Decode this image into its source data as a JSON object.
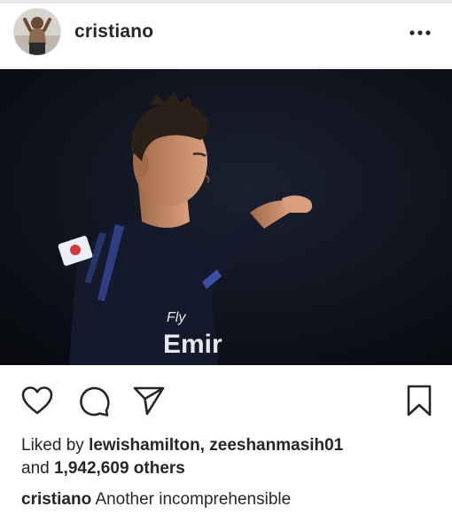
{
  "header": {
    "username": "cristiano",
    "more_icon": "more-horizontal-icon"
  },
  "post": {
    "image_alt": "Football player in dark jersey gesturing with hand",
    "jersey_sponsor": "Emir",
    "jersey_sponsor_top": "Fly"
  },
  "actions": {
    "like_icon": "heart-icon",
    "comment_icon": "comment-icon",
    "share_icon": "send-icon",
    "save_icon": "bookmark-icon"
  },
  "likes": {
    "prefix": "Liked by",
    "users": "lewishamilton, zeeshanmasih01",
    "conjunction": "and",
    "others_count": "1,942,609 others"
  },
  "caption": {
    "username": "cristiano",
    "text": "Another incomprehensible"
  },
  "colors": {
    "text": "#262626",
    "image_background": "#0e121b",
    "jersey": "#141a2c",
    "jersey_accent": "#3b4fa8"
  }
}
